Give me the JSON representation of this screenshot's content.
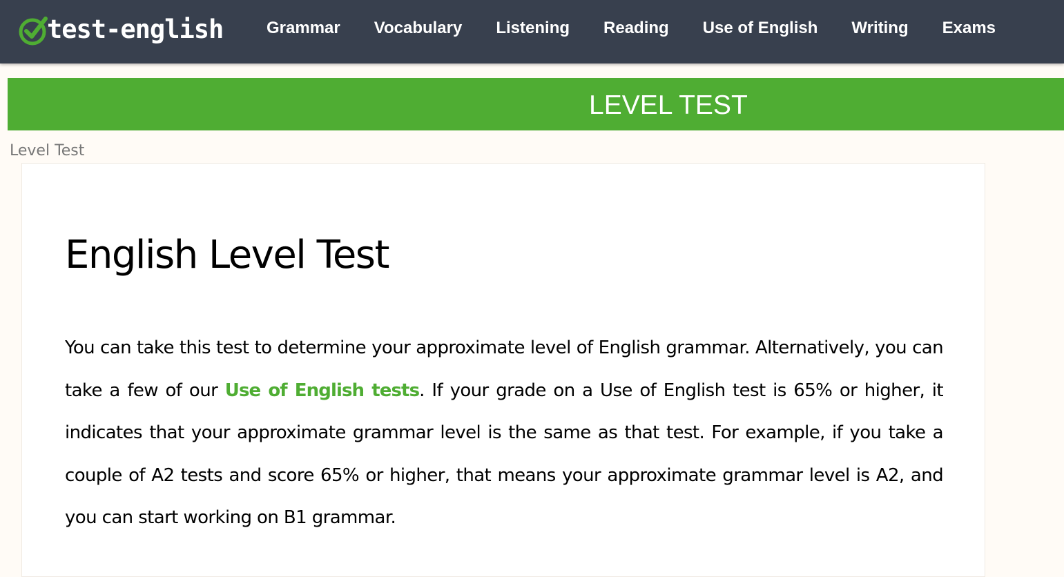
{
  "header": {
    "logo_text": "test-english",
    "logo_icon": "check-circle-icon",
    "nav": [
      {
        "label": "Grammar"
      },
      {
        "label": "Vocabulary"
      },
      {
        "label": "Listening"
      },
      {
        "label": "Reading"
      },
      {
        "label": "Use of English"
      },
      {
        "label": "Writing"
      },
      {
        "label": "Exams"
      }
    ]
  },
  "banner": {
    "title": "LEVEL TEST"
  },
  "breadcrumb": {
    "current": "Level Test"
  },
  "main": {
    "title": "English Level Test",
    "intro": {
      "part1": "You can take this test to determine your approximate level of English grammar. Alternatively, you can take a few of our ",
      "link": "Use of English tests",
      "part2": ". If your grade on a Use of English test is 65% or higher, it indicates that your approximate grammar level is the same as that test. For example, if you take a couple of A2 tests and score 65% or higher, that means your approximate grammar level is A2, and you can start working on B1 grammar."
    }
  },
  "colors": {
    "header_bg": "#38404e",
    "brand_green": "#4fad33",
    "page_bg": "#fffbf6"
  }
}
